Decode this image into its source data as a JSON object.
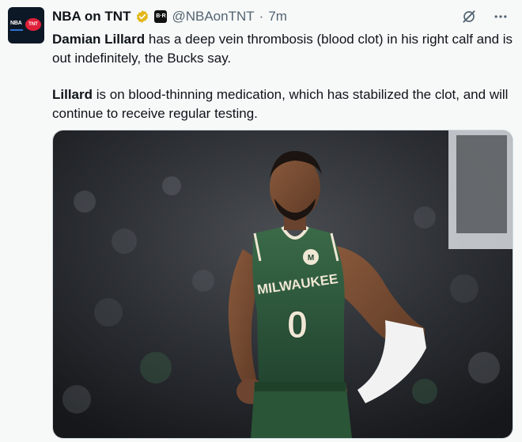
{
  "account": {
    "display_name": "NBA on TNT",
    "handle": "@NBAonTNT",
    "separator": "·",
    "timestamp": "7m",
    "avatar_nba": "NBA",
    "avatar_tnt": "TNT",
    "affiliate_badge": "B·R"
  },
  "tweet": {
    "p1_bold": "Damian Lillard",
    "p1_rest": " has a deep vein thrombosis (blood clot) in his right calf and is out indefinitely, the Bucks say.",
    "p2_bold": "Lillard",
    "p2_rest": " is on blood-thinning medication, which has stabilized the clot, and will continue to receive regular testing."
  },
  "media": {
    "jersey_team": "MILWAUKEE",
    "jersey_number": "0",
    "jersey_sponsor": "M"
  },
  "colors": {
    "jersey_green": "#2f5a3b",
    "jersey_trim": "#efe7d4",
    "verified_gold": "#e2b719",
    "court_background": "#2b2e33"
  },
  "icons": [
    "verified-icon",
    "grok-icon",
    "more-icon"
  ]
}
